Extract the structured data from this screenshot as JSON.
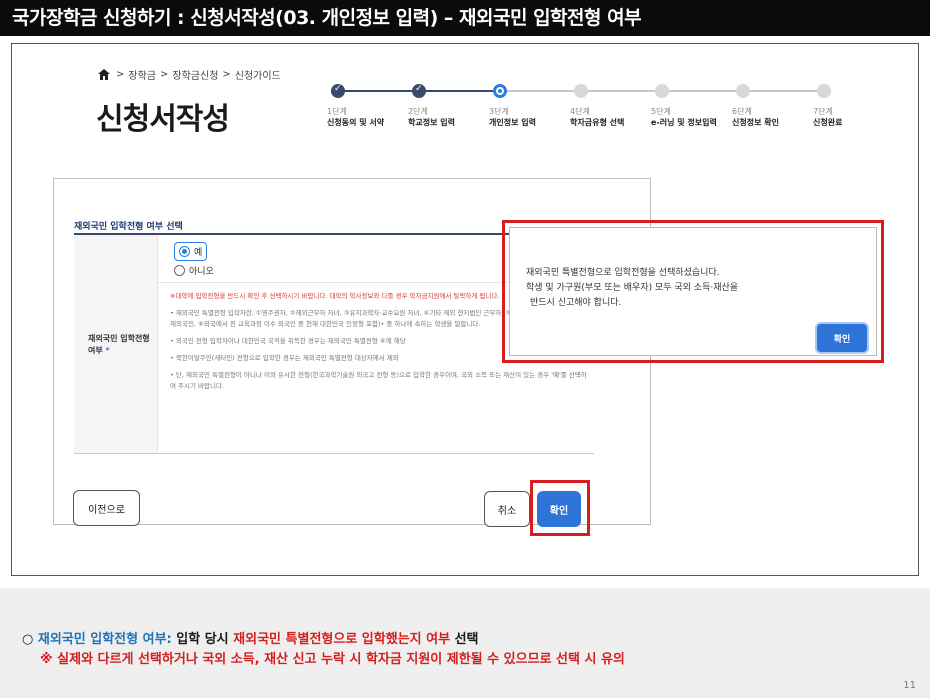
{
  "header": {
    "title": "국가장학금 신청하기 : 신청서작성(03. 개인정보 입력) – 재외국민 입학전형 여부"
  },
  "breadcrumb": {
    "items": [
      "장학금",
      "장학금신청",
      "신청가이드"
    ],
    "sep": ">"
  },
  "page_title": "신청서작성",
  "steps": [
    {
      "num": "1단계",
      "name": "신청동의 및 서약",
      "state": "done"
    },
    {
      "num": "2단계",
      "name": "학교정보 입력",
      "state": "done"
    },
    {
      "num": "3단계",
      "name": "개인정보 입력",
      "state": "current"
    },
    {
      "num": "4단계",
      "name": "학자금유형 선택",
      "state": "todo"
    },
    {
      "num": "5단계",
      "name": "e-러닝 및 정보입력",
      "state": "todo"
    },
    {
      "num": "6단계",
      "name": "신청정보 확인",
      "state": "todo"
    },
    {
      "num": "7단계",
      "name": "신청완료",
      "state": "todo"
    }
  ],
  "form": {
    "section_title": "재외국민 입학전형 여부 선택",
    "field_label": "재외국민 입학전형 여부",
    "required_mark": "*",
    "options": [
      {
        "label": "예",
        "selected": true
      },
      {
        "label": "아니오",
        "selected": false
      }
    ],
    "warning": "※대학에 입학전형을 반드시 확인 후 선택하시기 바랍니다. 대학의 학사정보와 다를 경우 학자금지원에서 탈락하게 됩니다.",
    "notes": [
      "• 재외국민 특별전형 입학자란, ①영주권자, ②해외근무자 자녀, ③유치과학자·교수요원 자녀, ④기타 재외 현지법인 근무자, ⑤외국에서 전 교육과정 이수 재외국민, ⑥외국에서 전 교육과정 이수 외국인 중 현재 대한민국 인정형 포함)• 중 하나에 속하는 학생을 말합니다.",
      "• 외국인 전형 입학자이나 대한민국 국적을 취득한 경우는 재외국민 특별전형 ⑥에 해당",
      "• 북한이탈주민(새터민) 전형으로 입학한 경우는 재외국민 특별전형 대상자에서 제외",
      "• 단, 재외국민 특별전형이 아니나 이와 유사한 전형(한국과학기술원 외국고 전형 등)으로 입학한 경우이며, 국외 소득 또는 재산이 있는 경우 '예'를 선택하여 주시기 바랍니다."
    ]
  },
  "buttons": {
    "prev": "이전으로",
    "cancel": "취소",
    "confirm": "확인"
  },
  "modal": {
    "lines": [
      "재외국민 특별전형으로 입학전형을 선택하셨습니다.",
      "학생 및 가구원(부모 또는 배우자) 모두 국외 소득·재산을",
      "반드시 신고해야 합니다."
    ],
    "confirm": "확인"
  },
  "footer": {
    "bullet": "○",
    "term": "재외국민 입학전형 여부:",
    "desc_a": " 입학 당시 ",
    "desc_b": "재외국민 특별전형으로 입학했는지 여부",
    "desc_c": " 선택",
    "caution": "※ 실제와 다르게 선택하거나 국외 소득, 재산 신고 누락 시 학자금 지원이 제한될 수 있으므로 선택 시 유의",
    "page_number": "11"
  },
  "colors": {
    "accent_blue": "#2e74d8",
    "highlight_red": "#d61e1e",
    "step_done": "#3a4a6a"
  }
}
